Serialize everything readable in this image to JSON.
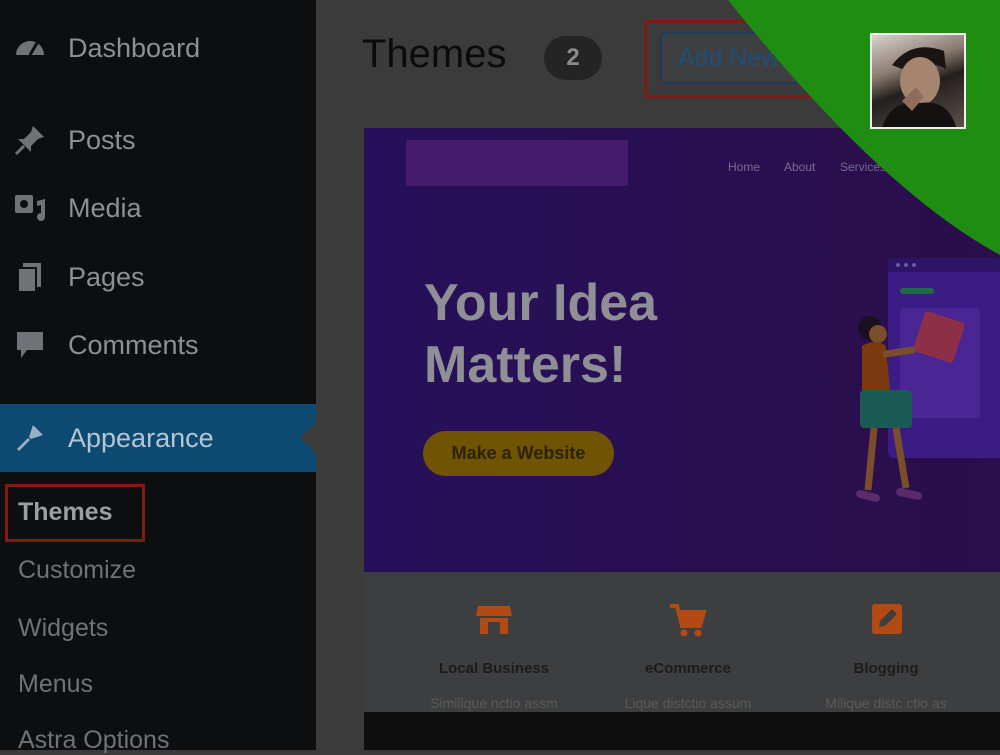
{
  "sidebar": {
    "items": [
      {
        "label": "Dashboard",
        "icon": "dashboard-icon"
      },
      {
        "label": "Posts",
        "icon": "pin-icon"
      },
      {
        "label": "Media",
        "icon": "media-icon"
      },
      {
        "label": "Pages",
        "icon": "pages-icon"
      },
      {
        "label": "Comments",
        "icon": "comment-icon"
      },
      {
        "label": "Appearance",
        "icon": "brush-icon"
      }
    ],
    "submenu": [
      "Themes",
      "Customize",
      "Widgets",
      "Menus",
      "Astra Options"
    ]
  },
  "header": {
    "title": "Themes",
    "count": "2",
    "add_new_label": "Add New"
  },
  "theme_preview": {
    "nav": [
      "Home",
      "About",
      "Services"
    ],
    "headline": "Your Idea Matters!",
    "cta_label": "Make a Website",
    "features": [
      {
        "title": "Local Business",
        "subtitle": "Similique nctio assm"
      },
      {
        "title": "eCommerce",
        "subtitle": "Lique distctio assum"
      },
      {
        "title": "Blogging",
        "subtitle": "Milique distc ctio as"
      }
    ]
  },
  "colors": {
    "sidebar_bg": "#0d0e10",
    "active_bg": "#0d4a72",
    "highlight_border": "#7d1b14",
    "accent_green": "#1f8d12",
    "feature_icon": "#b34a13"
  }
}
